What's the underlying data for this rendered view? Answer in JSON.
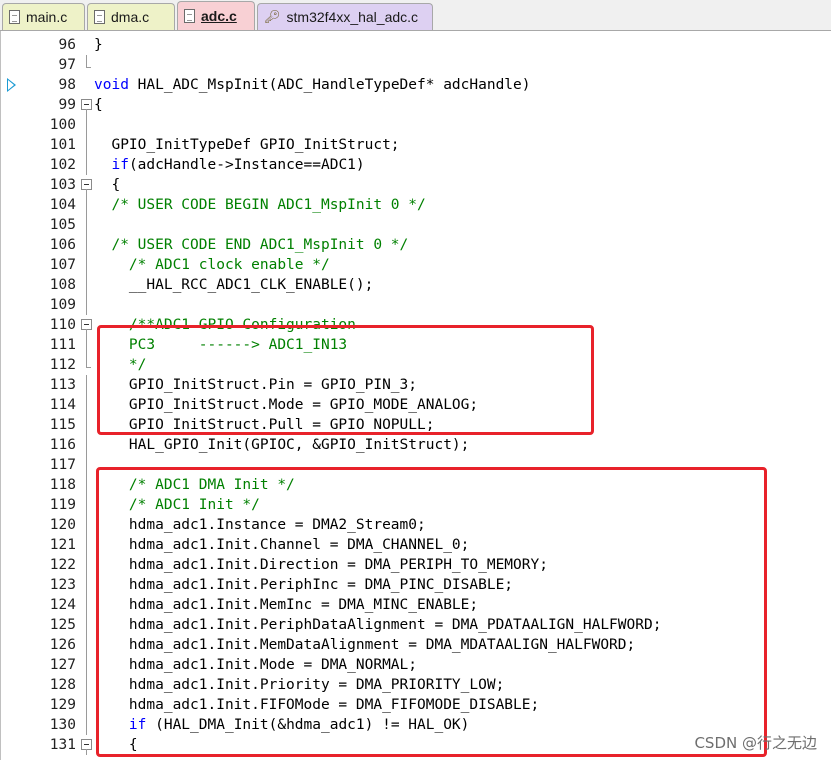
{
  "tabs": [
    {
      "label": "main.c",
      "icon": "c-file-icon",
      "color": "#eef2c8"
    },
    {
      "label": "dma.c",
      "icon": "c-file-icon",
      "color": "#eef2c8"
    },
    {
      "label": "adc.c",
      "icon": "c-file-icon",
      "color": "#f8d0d4",
      "active": true
    },
    {
      "label": "stm32f4xx_hal_adc.c",
      "icon": "key-file-icon",
      "color": "#ddd0f2"
    }
  ],
  "editor": {
    "current_line": "98",
    "lines": [
      {
        "n": "96",
        "fold": "none",
        "segs": [
          {
            "t": "}",
            "c": ""
          }
        ]
      },
      {
        "n": "97",
        "fold": "end",
        "segs": []
      },
      {
        "n": "98",
        "fold": "none",
        "segs": [
          {
            "t": "void",
            "c": "kw"
          },
          {
            "t": " HAL_ADC_MspInit(ADC_HandleTypeDef* adcHandle)",
            "c": ""
          }
        ]
      },
      {
        "n": "99",
        "fold": "open",
        "segs": [
          {
            "t": "{",
            "c": ""
          }
        ]
      },
      {
        "n": "100",
        "fold": "line",
        "segs": []
      },
      {
        "n": "101",
        "fold": "line",
        "segs": [
          {
            "t": "  GPIO_InitTypeDef GPIO_InitStruct;",
            "c": ""
          }
        ]
      },
      {
        "n": "102",
        "fold": "line",
        "segs": [
          {
            "t": "  ",
            "c": ""
          },
          {
            "t": "if",
            "c": "kw"
          },
          {
            "t": "(adcHandle->Instance==ADC1)",
            "c": ""
          }
        ]
      },
      {
        "n": "103",
        "fold": "open",
        "segs": [
          {
            "t": "  {",
            "c": ""
          }
        ]
      },
      {
        "n": "104",
        "fold": "line",
        "segs": [
          {
            "t": "  /* USER CODE BEGIN ADC1_MspInit 0 */",
            "c": "cm"
          }
        ]
      },
      {
        "n": "105",
        "fold": "line",
        "segs": []
      },
      {
        "n": "106",
        "fold": "line",
        "segs": [
          {
            "t": "  /* USER CODE END ADC1_MspInit 0 */",
            "c": "cm"
          }
        ]
      },
      {
        "n": "107",
        "fold": "line",
        "segs": [
          {
            "t": "    /* ADC1 clock enable */",
            "c": "cm"
          }
        ]
      },
      {
        "n": "108",
        "fold": "line",
        "segs": [
          {
            "t": "    __HAL_RCC_ADC1_CLK_ENABLE();",
            "c": ""
          }
        ]
      },
      {
        "n": "109",
        "fold": "line",
        "segs": []
      },
      {
        "n": "110",
        "fold": "open",
        "segs": [
          {
            "t": "    /**ADC1 GPIO Configuration",
            "c": "cm"
          }
        ]
      },
      {
        "n": "111",
        "fold": "line",
        "segs": [
          {
            "t": "    PC3     ------> ADC1_IN13",
            "c": "cm"
          }
        ]
      },
      {
        "n": "112",
        "fold": "end",
        "segs": [
          {
            "t": "    */",
            "c": "cm"
          }
        ]
      },
      {
        "n": "113",
        "fold": "line",
        "segs": [
          {
            "t": "    GPIO_InitStruct.Pin = GPIO_PIN_3;",
            "c": ""
          }
        ]
      },
      {
        "n": "114",
        "fold": "line",
        "segs": [
          {
            "t": "    GPIO_InitStruct.Mode = GPIO_MODE_ANALOG;",
            "c": ""
          }
        ]
      },
      {
        "n": "115",
        "fold": "line",
        "segs": [
          {
            "t": "    GPIO_InitStruct.Pull = GPIO_NOPULL;",
            "c": ""
          }
        ]
      },
      {
        "n": "116",
        "fold": "line",
        "segs": [
          {
            "t": "    HAL_GPIO_Init(GPIOC, &GPIO_InitStruct);",
            "c": ""
          }
        ]
      },
      {
        "n": "117",
        "fold": "line",
        "segs": []
      },
      {
        "n": "118",
        "fold": "line",
        "segs": [
          {
            "t": "    /* ADC1 DMA Init */",
            "c": "cm"
          }
        ]
      },
      {
        "n": "119",
        "fold": "line",
        "segs": [
          {
            "t": "    /* ADC1 Init */",
            "c": "cm"
          }
        ]
      },
      {
        "n": "120",
        "fold": "line",
        "segs": [
          {
            "t": "    hdma_adc1.Instance = DMA2_Stream0;",
            "c": ""
          }
        ]
      },
      {
        "n": "121",
        "fold": "line",
        "segs": [
          {
            "t": "    hdma_adc1.Init.Channel = DMA_CHANNEL_0;",
            "c": ""
          }
        ]
      },
      {
        "n": "122",
        "fold": "line",
        "segs": [
          {
            "t": "    hdma_adc1.Init.Direction = DMA_PERIPH_TO_MEMORY;",
            "c": ""
          }
        ]
      },
      {
        "n": "123",
        "fold": "line",
        "segs": [
          {
            "t": "    hdma_adc1.Init.PeriphInc = DMA_PINC_DISABLE;",
            "c": ""
          }
        ]
      },
      {
        "n": "124",
        "fold": "line",
        "segs": [
          {
            "t": "    hdma_adc1.Init.MemInc = DMA_MINC_ENABLE;",
            "c": ""
          }
        ]
      },
      {
        "n": "125",
        "fold": "line",
        "segs": [
          {
            "t": "    hdma_adc1.Init.PeriphDataAlignment = DMA_PDATAALIGN_HALFWORD;",
            "c": ""
          }
        ]
      },
      {
        "n": "126",
        "fold": "line",
        "segs": [
          {
            "t": "    hdma_adc1.Init.MemDataAlignment = DMA_MDATAALIGN_HALFWORD;",
            "c": ""
          }
        ]
      },
      {
        "n": "127",
        "fold": "line",
        "segs": [
          {
            "t": "    hdma_adc1.Init.Mode = DMA_NORMAL;",
            "c": ""
          }
        ]
      },
      {
        "n": "128",
        "fold": "line",
        "segs": [
          {
            "t": "    hdma_adc1.Init.Priority = DMA_PRIORITY_LOW;",
            "c": ""
          }
        ]
      },
      {
        "n": "129",
        "fold": "line",
        "segs": [
          {
            "t": "    hdma_adc1.Init.FIFOMode = DMA_FIFOMODE_DISABLE;",
            "c": ""
          }
        ]
      },
      {
        "n": "130",
        "fold": "line",
        "segs": [
          {
            "t": "    ",
            "c": ""
          },
          {
            "t": "if",
            "c": "kw"
          },
          {
            "t": " (HAL_DMA_Init(&hdma_adc1) != HAL_OK)",
            "c": ""
          }
        ]
      },
      {
        "n": "131",
        "fold": "open",
        "segs": [
          {
            "t": "    {",
            "c": ""
          }
        ]
      }
    ]
  },
  "colors": {
    "keyword": "#0000ff",
    "comment": "#008000",
    "highlight_box": "#e8222a",
    "current_line_marker": "#1c9bd4"
  },
  "watermark": "CSDN @行之无边"
}
